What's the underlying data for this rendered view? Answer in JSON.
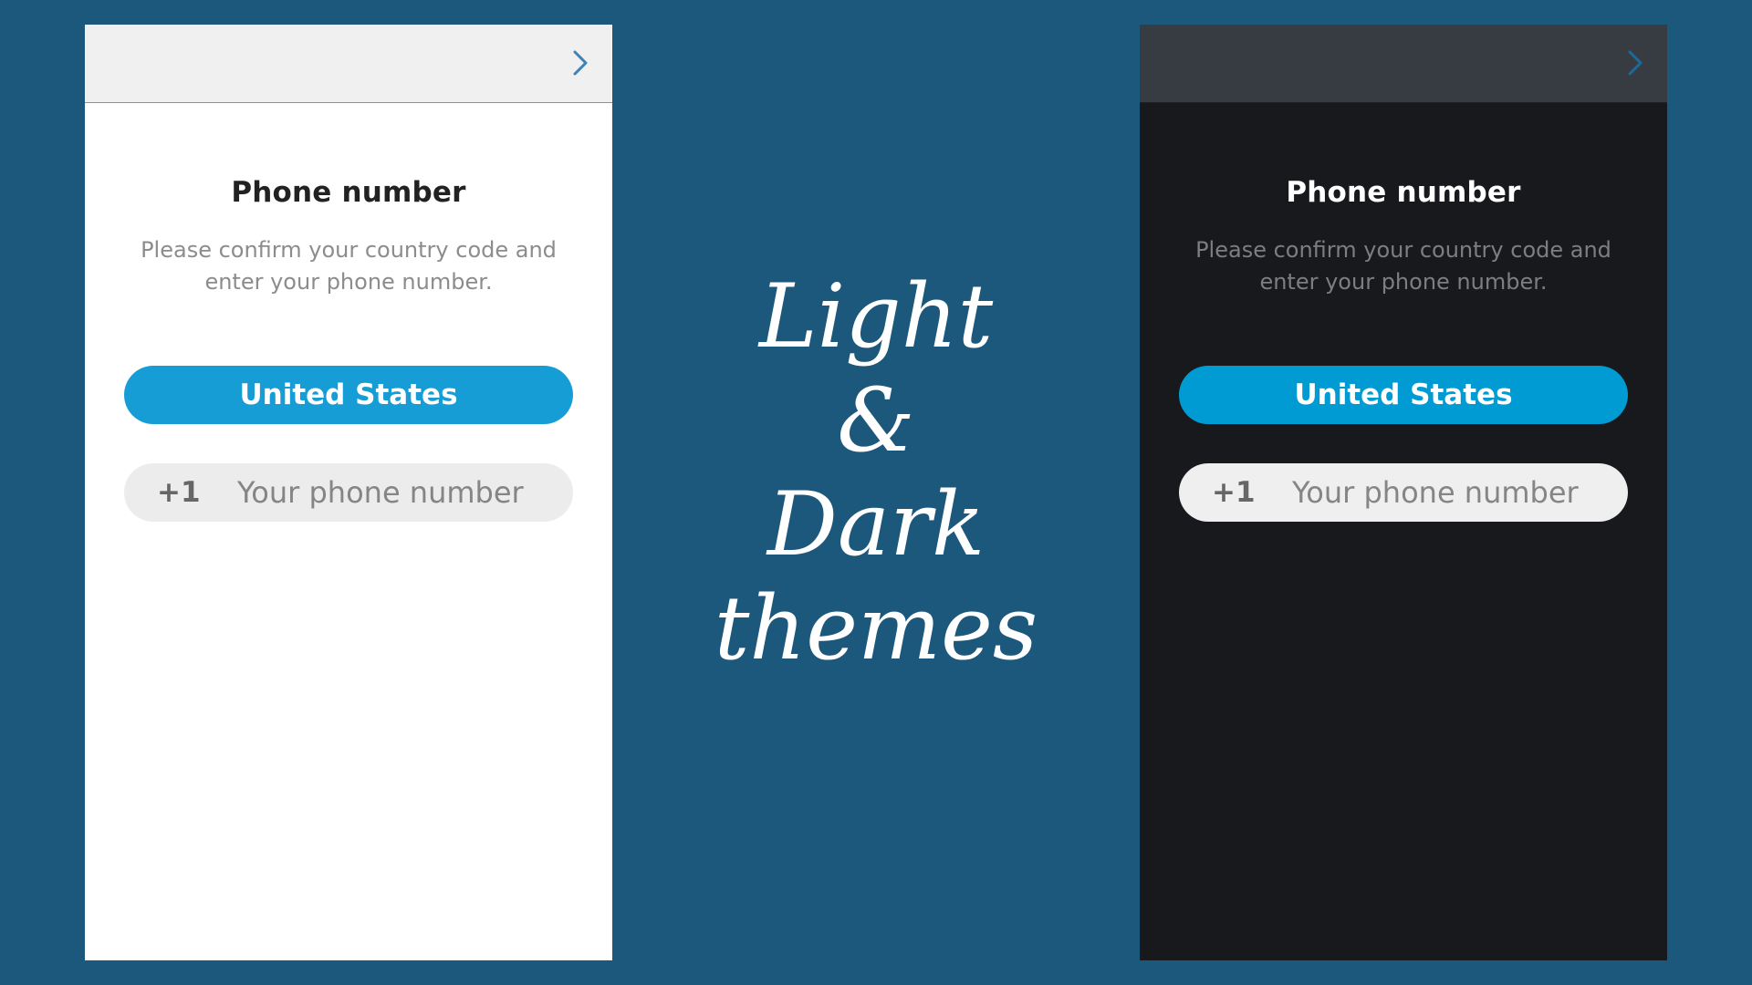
{
  "colors": {
    "background": "#1c577c",
    "accent_blue_light": "#179dd5",
    "accent_blue_dark": "#019bd3",
    "light_panel_bg": "#ffffff",
    "dark_panel_bg": "#18191d",
    "chevron_light": "#3e82b6",
    "chevron_dark": "#1b6a9a"
  },
  "light_panel": {
    "next_icon": "chevron-right-icon",
    "title": "Phone number",
    "subtitle": "Please confirm your country code and enter your phone number.",
    "country_button_label": "United States",
    "country_code": "+1",
    "phone_placeholder": "Your phone number",
    "phone_value": ""
  },
  "dark_panel": {
    "next_icon": "chevron-right-icon",
    "title": "Phone number",
    "subtitle": "Please confirm your country code and enter your phone number.",
    "country_button_label": "United States",
    "country_code": "+1",
    "phone_placeholder": "Your phone number",
    "phone_value": ""
  },
  "headline": {
    "line1": "Light",
    "line2": "&",
    "line3": "Dark",
    "line4": "themes"
  }
}
